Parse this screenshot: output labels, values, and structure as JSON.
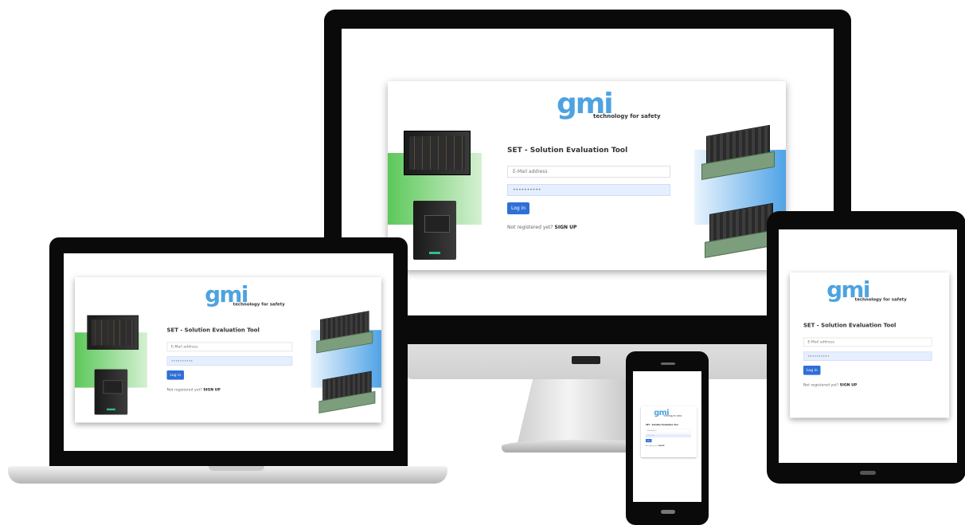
{
  "login": {
    "logo_text": "gmi",
    "tagline": "technology for safety",
    "title": "SET - Solution Evaluation Tool",
    "email_placeholder": "E-Mail address",
    "password_mask": "••••••••••",
    "login_button": "Log in",
    "signup_prompt": "Not registered yet?",
    "signup_link": "SIGN UP"
  },
  "colors": {
    "brand_blue": "#4da3e0",
    "button_blue": "#2f6fd6",
    "accent_green": "#5cc85a",
    "accent_blue": "#4fa3e6"
  }
}
